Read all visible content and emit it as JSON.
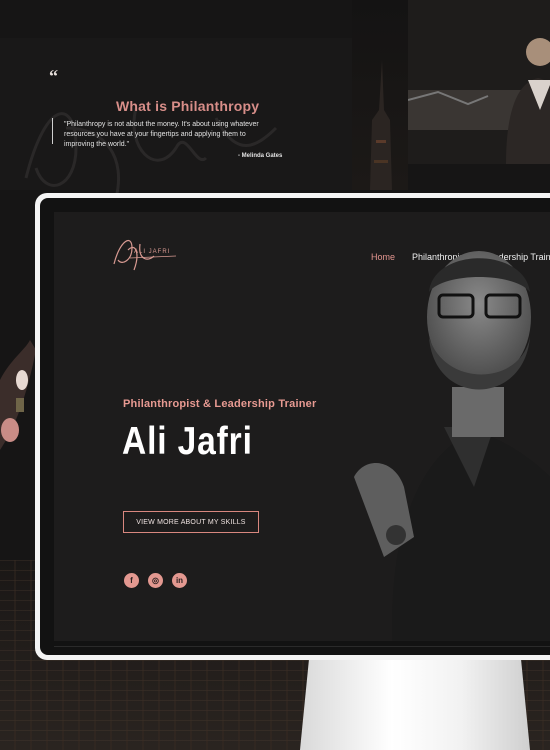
{
  "collage": {
    "quote": {
      "mark": "“",
      "title": "What is Philanthropy",
      "text": "\"Philanthropy is not about the money. It's about using whatever resources you have at your fingertips and applying them to improving the world.\"",
      "author": "- Melinda Gates"
    }
  },
  "site": {
    "logo_text": "ALI JAFRI",
    "nav": [
      {
        "label": "Home",
        "active": true
      },
      {
        "label": "Philanthropist",
        "active": false
      },
      {
        "label": "Leadership Trainer",
        "active": false
      }
    ],
    "hero": {
      "subtitle": "Philanthropist & Leadership Trainer",
      "name": "Ali Jafri",
      "cta_label": "VIEW MORE ABOUT MY SKILLS"
    },
    "social": [
      {
        "icon": "facebook-icon",
        "glyph": "f"
      },
      {
        "icon": "instagram-icon",
        "glyph": "◎"
      },
      {
        "icon": "linkedin-icon",
        "glyph": "in"
      }
    ]
  },
  "colors": {
    "accent": "#e3958f",
    "background": "#1d1c1c",
    "monitor_frame": "#f4f4f4"
  }
}
